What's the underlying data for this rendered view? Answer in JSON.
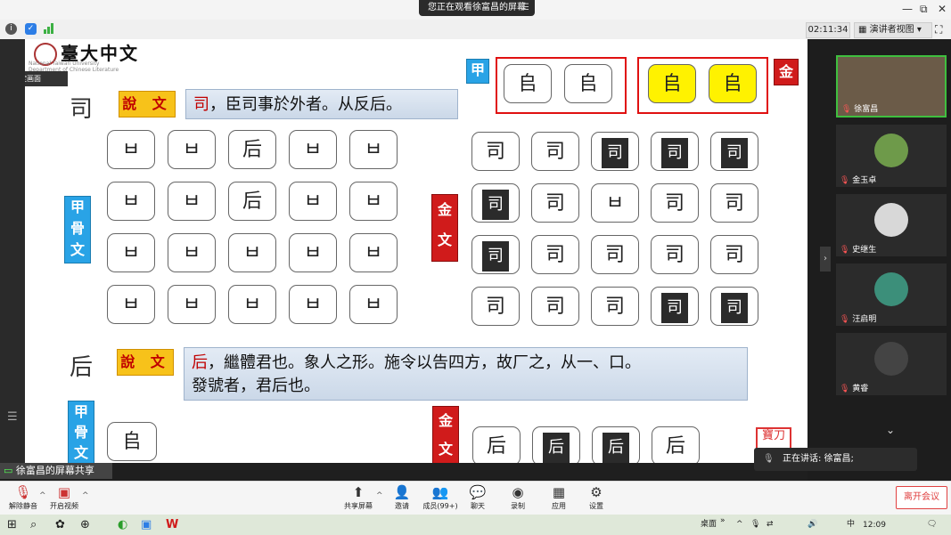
{
  "topbar": {
    "share_status": "您正在观看徐富昌的屏幕",
    "share_menu_icon": "menu-icon",
    "window_controls": [
      "—",
      "⧉",
      "✕"
    ]
  },
  "infobar": {
    "icons": [
      "info-icon",
      "shield-icon",
      "signal-icon"
    ],
    "timer": "02:11:34",
    "view_button": "演讲者视图",
    "fullscreen_icon": "fullscreen-icon"
  },
  "pin_tooltip": "锁定画面",
  "slide": {
    "logo_cn": "臺大中文",
    "logo_en_1": "National Taiwan University",
    "logo_en_2": "Department of Chinese Literature",
    "section1": {
      "char": "司",
      "shuowen_label": "說 文",
      "def_highlight": "司",
      "def_text": "，臣司事於外者。从反后。"
    },
    "jia_small_label": "甲",
    "jin_small_label": "金",
    "jiaguwen_label": [
      "甲",
      "骨",
      "文"
    ],
    "jinwen_label": [
      "金",
      "文"
    ],
    "oracle_grid": [
      [
        "ㅂ",
        "ㅂ",
        "后",
        "ㅂ",
        "ㅂ"
      ],
      [
        "ㅂ",
        "ㅂ",
        "后",
        "ㅂ",
        "ㅂ"
      ],
      [
        "ㅂ",
        "ㅂ",
        "ㅂ",
        "ㅂ",
        "ㅂ"
      ],
      [
        "ㅂ",
        "ㅂ",
        "ㅂ",
        "ㅂ",
        "ㅂ"
      ]
    ],
    "bronze_grid": [
      [
        "司",
        "司",
        "司",
        "司",
        "司"
      ],
      [
        "司",
        "司",
        "ㅂ",
        "司",
        "司"
      ],
      [
        "司",
        "司",
        "司",
        "司",
        "司"
      ],
      [
        "司",
        "司",
        "司",
        "司",
        "司"
      ]
    ],
    "jia_top_tiles": [
      "𠂤",
      "𠂤"
    ],
    "jin_top_tiles": [
      "𠂤",
      "𠂤"
    ],
    "section2": {
      "char": "后",
      "shuowen_label": "說 文",
      "def_highlight": "后",
      "def_line1": "，繼體君也。象人之形。施令以告四方，故厂之，从一、口。",
      "def_line2": "發號者，君后也。"
    },
    "oracle_row2": [
      "𠂤"
    ],
    "bronze_row2": [
      "后",
      "后",
      "后",
      "后"
    ],
    "seal_text": "寶刀"
  },
  "share_label": "徐富昌的屏幕共享",
  "participants": [
    {
      "name": "徐富昌",
      "active": true
    },
    {
      "name": "金玉卓",
      "active": false
    },
    {
      "name": "史继生",
      "active": false
    },
    {
      "name": "汪启明",
      "active": false
    },
    {
      "name": "黄睿",
      "active": false
    }
  ],
  "speaking": {
    "prefix": "正在讲话:",
    "name": "徐富昌;"
  },
  "toolbar": {
    "mute": "解除静音",
    "video": "开启视频",
    "share": "共享屏幕",
    "invite": "邀请",
    "members": "成员(99+)",
    "chat": "聊天",
    "record": "录制",
    "apps": "应用",
    "settings": "设置",
    "leave": "离开会议"
  },
  "taskbar": {
    "desktop": "桌面",
    "time": "12:09",
    "ime": "中",
    "chevron": "»"
  },
  "colors": {
    "shuowen_bg": "#f7c21a",
    "highlight_red": "#c00000",
    "label_blue": "#29a3e6",
    "label_red": "#d01b1b",
    "yellow_tile": "#fff200"
  }
}
